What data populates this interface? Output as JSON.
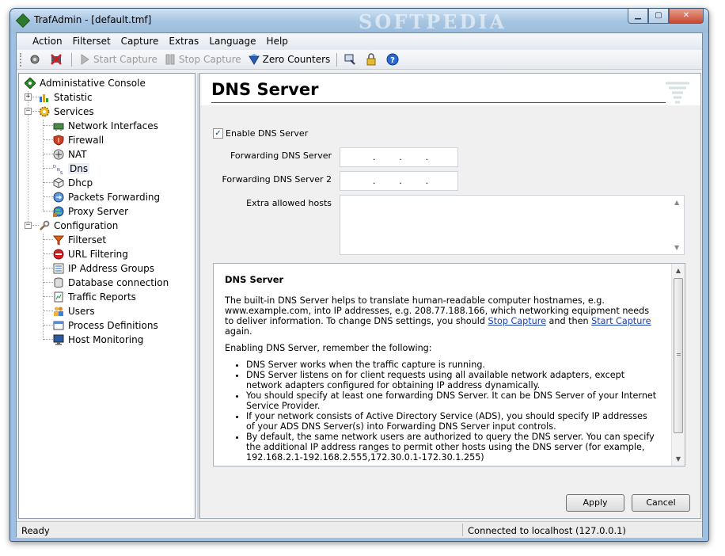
{
  "window": {
    "title": "TrafAdmin - [default.tmf]",
    "watermark": "SOFTPEDIA",
    "controls": {
      "minimize": "▁",
      "maximize": "▢",
      "close": "✕"
    }
  },
  "menu": [
    "Action",
    "Filterset",
    "Capture",
    "Extras",
    "Language",
    "Help"
  ],
  "toolbar": {
    "start_capture": "Start Capture",
    "stop_capture": "Stop Capture",
    "zero_counters": "Zero Counters"
  },
  "tree": {
    "root": "Administative Console",
    "statistic": "Statistic",
    "services": "Services",
    "services_items": [
      "Network Interfaces",
      "Firewall",
      "NAT",
      "Dns",
      "Dhcp",
      "Packets Forwarding",
      "Proxy Server"
    ],
    "configuration": "Configuration",
    "configuration_items": [
      "Filterset",
      "URL Filtering",
      "IP Address Groups",
      "Database connection",
      "Traffic Reports",
      "Users",
      "Process Definitions",
      "Host Monitoring"
    ]
  },
  "content": {
    "title": "DNS Server",
    "enable_label": "Enable DNS Server",
    "enable_checked": "✓",
    "fwd1_label": "Forwarding DNS Server",
    "fwd2_label": "Forwarding DNS Server 2",
    "ip_dot": ".",
    "hosts_label": "Extra allowed hosts",
    "scroll_up": "▲",
    "scroll_down": "▼"
  },
  "help": {
    "title": "DNS Server",
    "p1_a": "The built-in DNS Server helps to translate human-readable computer hostnames, e.g. www.example.com, into IP addresses, e.g. 208.77.188.166, which networking equipment needs to deliver information. To change DNS settings, you should ",
    "p1_link1": "Stop Capture",
    "p1_b": " and then ",
    "p1_link2": "Start Capture",
    "p1_c": " again.",
    "p2": "Enabling DNS Server, remember the following:",
    "bullets": [
      "DNS Server works when the traffic capture is running.",
      "DNS Server listens on for client requests using all available network adapters, except network adapters configured for obtaining IP address dynamically.",
      "You should specify at least one forwarding DNS Server. It can be DNS Server of your Internet Service Provider.",
      "If your network consists of Active Directory Service (ADS), you should specify IP addresses of your ADS DNS Server(s) into Forwarding DNS Server input controls.",
      "By default, the same network users are authorized to query the DNS server. You can specify the additional IP address ranges to permit other hosts using the DNS server (for example, 192.168.2.1-192.168.2.555,172.30.0.1-172.30.1.255)"
    ]
  },
  "buttons": {
    "apply": "Apply",
    "cancel": "Cancel"
  },
  "status": {
    "left": "Ready",
    "right": "Connected to localhost (127.0.0.1)"
  }
}
